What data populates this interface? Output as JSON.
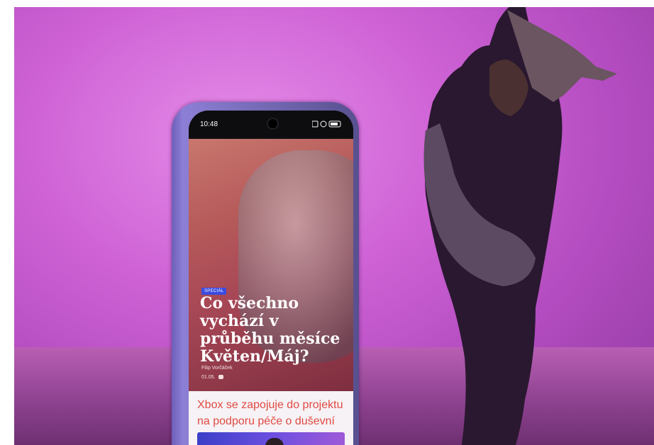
{
  "phone": {
    "status_time": "10:48",
    "article": {
      "badge": "SPECIÁL",
      "headline": "Co všechno vychází v průběhu měsíce Květen/Máj?",
      "author": "Filip Vorčáček",
      "date": "01.05."
    },
    "next_article": {
      "title": "Xbox se zapojuje do projektu na podporu péče o duševní zdraví"
    }
  },
  "colors": {
    "background": "#d56ad9",
    "phone_frame": "#7d70c8",
    "headline_card_title": "#e04a44",
    "badge": "#3a4be0"
  }
}
